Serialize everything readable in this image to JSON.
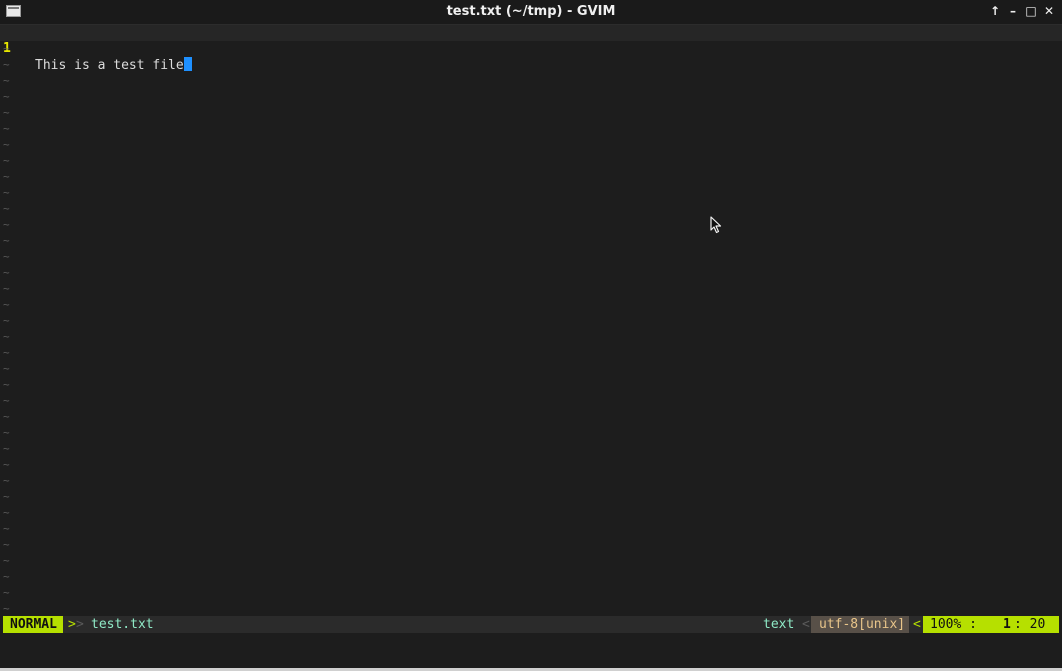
{
  "window": {
    "title": "test.txt (~/tmp) - GVIM",
    "icons": [
      "app-menu-icon",
      "keep-above-icon",
      "minimize-icon",
      "maximize-icon",
      "close-icon"
    ],
    "btn_glyphs": {
      "keep_above": "↑",
      "minimize": "–",
      "maximize": "□",
      "close": "✕"
    }
  },
  "editor": {
    "lines": [
      {
        "number": "1",
        "text": "This is a test file"
      }
    ],
    "empty_marker": "~",
    "colors": {
      "background": "#1d1d1d",
      "line_number": "#e8e800",
      "cursor": "#1e90ff",
      "text": "#dcdcdc"
    }
  },
  "statusline": {
    "mode": "NORMAL",
    "sep_right": ">",
    "filename": "test.txt",
    "filetype": "text",
    "sep_left": "<",
    "encoding": "utf-8[unix]",
    "percent": "100% :",
    "line": "1",
    "col": ": 20",
    "colors": {
      "mode_bg": "#b6e000",
      "filename": "#8fe9c6",
      "encoding_bg": "#585048",
      "encoding_fg": "#e8c58a"
    }
  }
}
